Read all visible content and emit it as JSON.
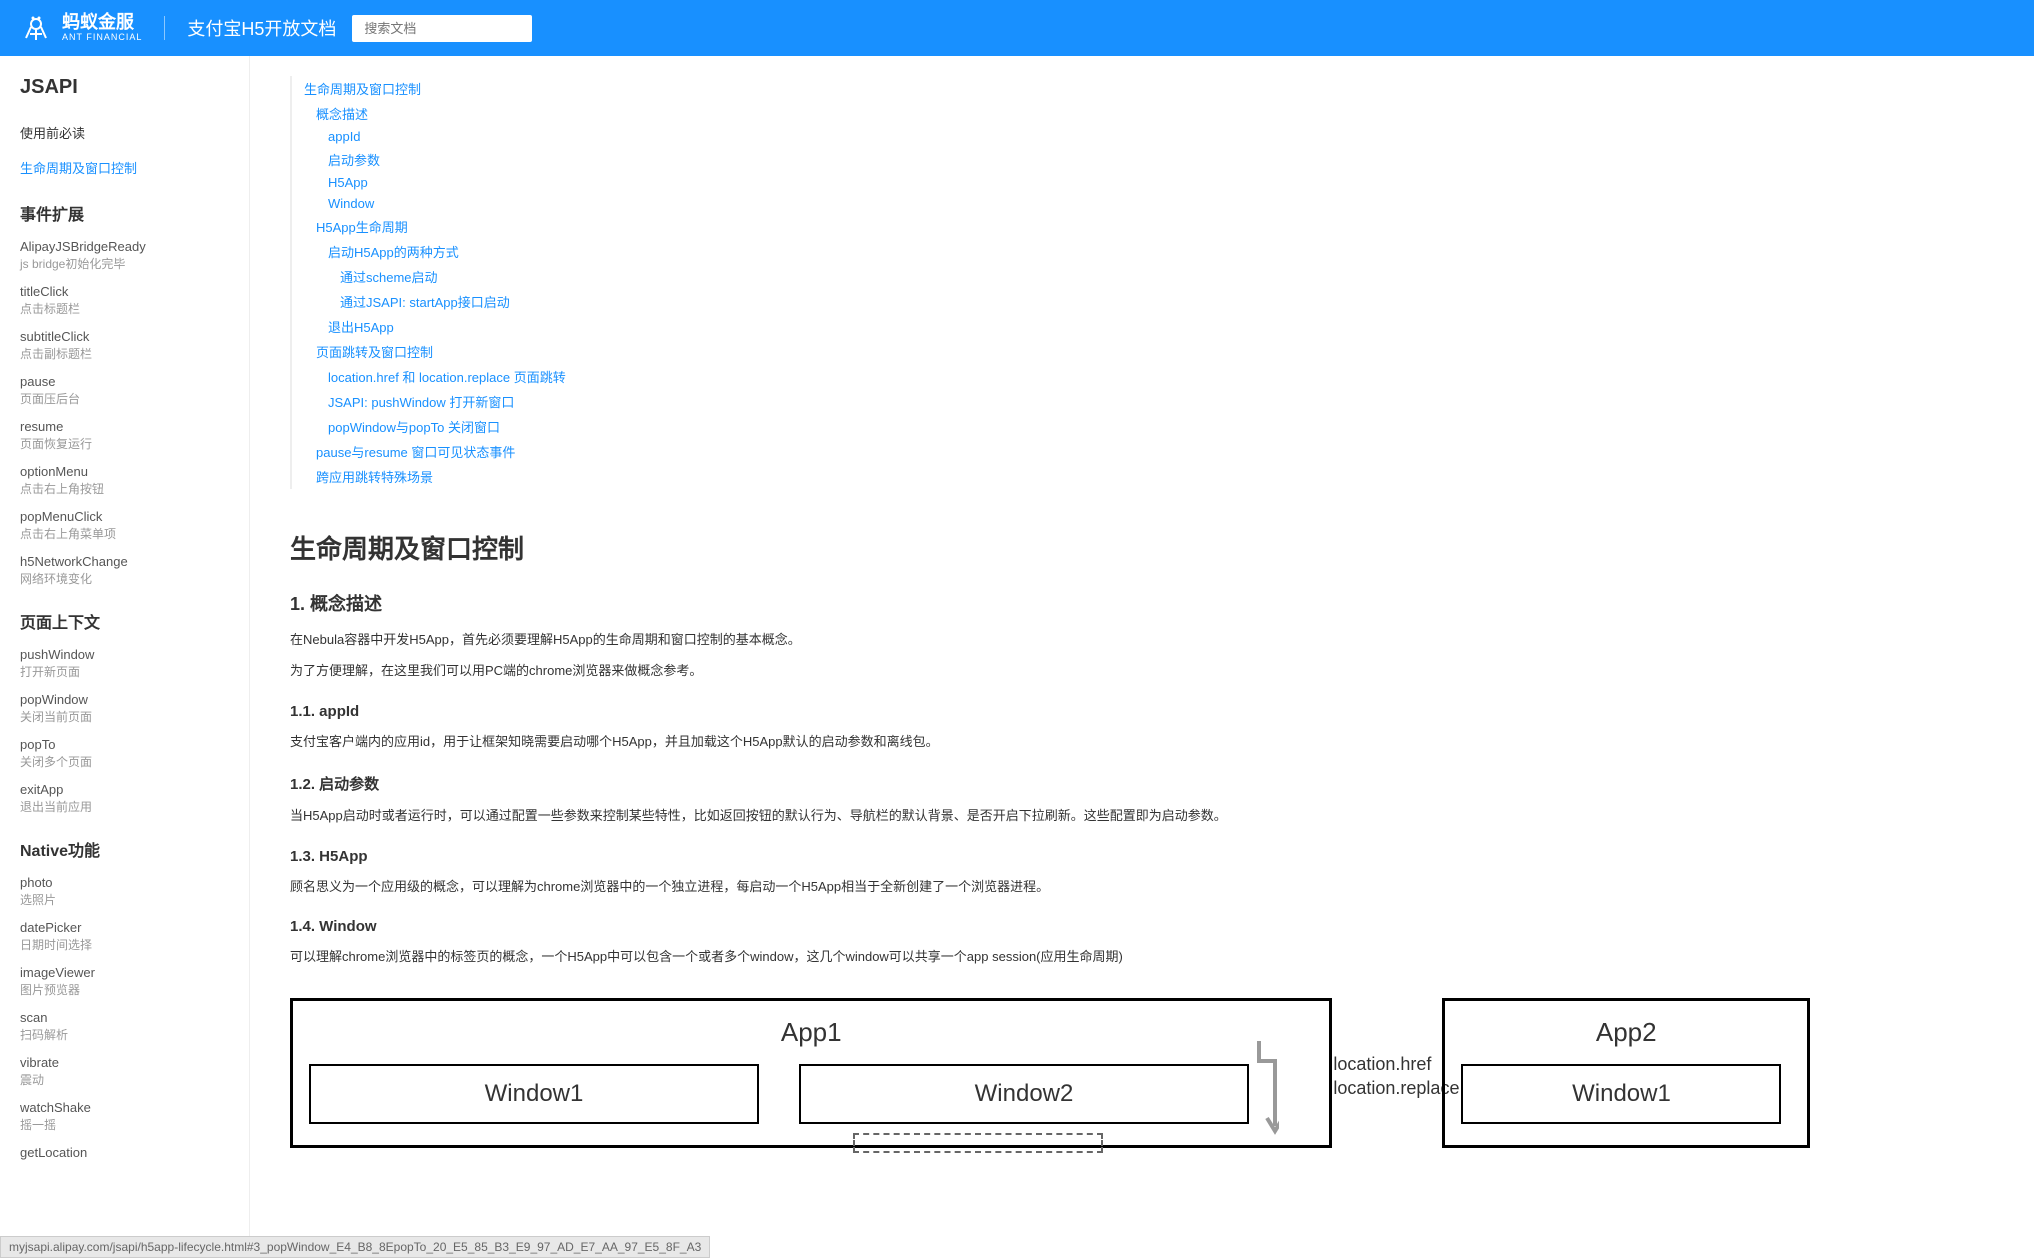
{
  "header": {
    "logo_main": "蚂蚁金服",
    "logo_sub": "ANT FINANCIAL",
    "doc_title": "支付宝H5开放文档",
    "search_placeholder": "搜索文档"
  },
  "sidebar": {
    "title": "JSAPI",
    "top_items": [
      {
        "label": "使用前必读",
        "active": false
      },
      {
        "label": "生命周期及窗口控制",
        "active": true
      }
    ],
    "sections": [
      {
        "title": "事件扩展",
        "items": [
          {
            "name": "AlipayJSBridgeReady",
            "desc": "js bridge初始化完毕"
          },
          {
            "name": "titleClick",
            "desc": "点击标题栏"
          },
          {
            "name": "subtitleClick",
            "desc": "点击副标题栏"
          },
          {
            "name": "pause",
            "desc": "页面压后台"
          },
          {
            "name": "resume",
            "desc": "页面恢复运行"
          },
          {
            "name": "optionMenu",
            "desc": "点击右上角按钮"
          },
          {
            "name": "popMenuClick",
            "desc": "点击右上角菜单项"
          },
          {
            "name": "h5NetworkChange",
            "desc": "网络环境变化"
          }
        ]
      },
      {
        "title": "页面上下文",
        "items": [
          {
            "name": "pushWindow",
            "desc": "打开新页面"
          },
          {
            "name": "popWindow",
            "desc": "关闭当前页面"
          },
          {
            "name": "popTo",
            "desc": "关闭多个页面"
          },
          {
            "name": "exitApp",
            "desc": "退出当前应用"
          }
        ]
      },
      {
        "title": "Native功能",
        "items": [
          {
            "name": "photo",
            "desc": "选照片"
          },
          {
            "name": "datePicker",
            "desc": "日期时间选择"
          },
          {
            "name": "imageViewer",
            "desc": "图片预览器"
          },
          {
            "name": "scan",
            "desc": "扫码解析"
          },
          {
            "name": "vibrate",
            "desc": "震动"
          },
          {
            "name": "watchShake",
            "desc": "摇一摇"
          },
          {
            "name": "getLocation",
            "desc": ""
          }
        ]
      }
    ]
  },
  "toc": [
    {
      "label": "生命周期及窗口控制",
      "level": 1
    },
    {
      "label": "概念描述",
      "level": 2
    },
    {
      "label": "appId",
      "level": 3
    },
    {
      "label": "启动参数",
      "level": 3
    },
    {
      "label": "H5App",
      "level": 3
    },
    {
      "label": "Window",
      "level": 3
    },
    {
      "label": "H5App生命周期",
      "level": 2
    },
    {
      "label": "启动H5App的两种方式",
      "level": 3
    },
    {
      "label": "通过scheme启动",
      "level": 4
    },
    {
      "label": "通过JSAPI: startApp接口启动",
      "level": 4
    },
    {
      "label": "退出H5App",
      "level": 3
    },
    {
      "label": "页面跳转及窗口控制",
      "level": 2
    },
    {
      "label": "location.href 和 location.replace 页面跳转",
      "level": 3
    },
    {
      "label": "JSAPI: pushWindow 打开新窗口",
      "level": 3
    },
    {
      "label": "popWindow与popTo 关闭窗口",
      "level": 3
    },
    {
      "label": "pause与resume 窗口可见状态事件",
      "level": 2
    },
    {
      "label": "跨应用跳转特殊场景",
      "level": 2
    }
  ],
  "article": {
    "h1": "生命周期及窗口控制",
    "s1_title": "1. 概念描述",
    "s1_p1": "在Nebula容器中开发H5App，首先必须要理解H5App的生命周期和窗口控制的基本概念。",
    "s1_p2": "为了方便理解，在这里我们可以用PC端的chrome浏览器来做概念参考。",
    "s11_title": "1.1. appId",
    "s11_p1": "支付宝客户端内的应用id，用于让框架知晓需要启动哪个H5App，并且加载这个H5App默认的启动参数和离线包。",
    "s12_title": "1.2. 启动参数",
    "s12_p1": "当H5App启动时或者运行时，可以通过配置一些参数来控制某些特性，比如返回按钮的默认行为、导航栏的默认背景、是否开启下拉刷新。这些配置即为启动参数。",
    "s13_title": "1.3. H5App",
    "s13_p1": "顾名思义为一个应用级的概念，可以理解为chrome浏览器中的一个独立进程，每启动一个H5App相当于全新创建了一个浏览器进程。",
    "s14_title": "1.4. Window",
    "s14_p1": "可以理解chrome浏览器中的标签页的概念，一个H5App中可以包含一个或者多个window，这几个window可以共享一个app session(应用生命周期)"
  },
  "diagram": {
    "app1_title": "App1",
    "app2_title": "App2",
    "window1": "Window1",
    "window2": "Window2",
    "app2_window1": "Window1",
    "location_href": "location.href",
    "location_replace": "location.replace"
  },
  "status_bar": "myjsapi.alipay.com/jsapi/h5app-lifecycle.html#3_popWindow_E4_B8_8EpopTo_20_E5_85_B3_E9_97_AD_E7_AA_97_E5_8F_A3"
}
